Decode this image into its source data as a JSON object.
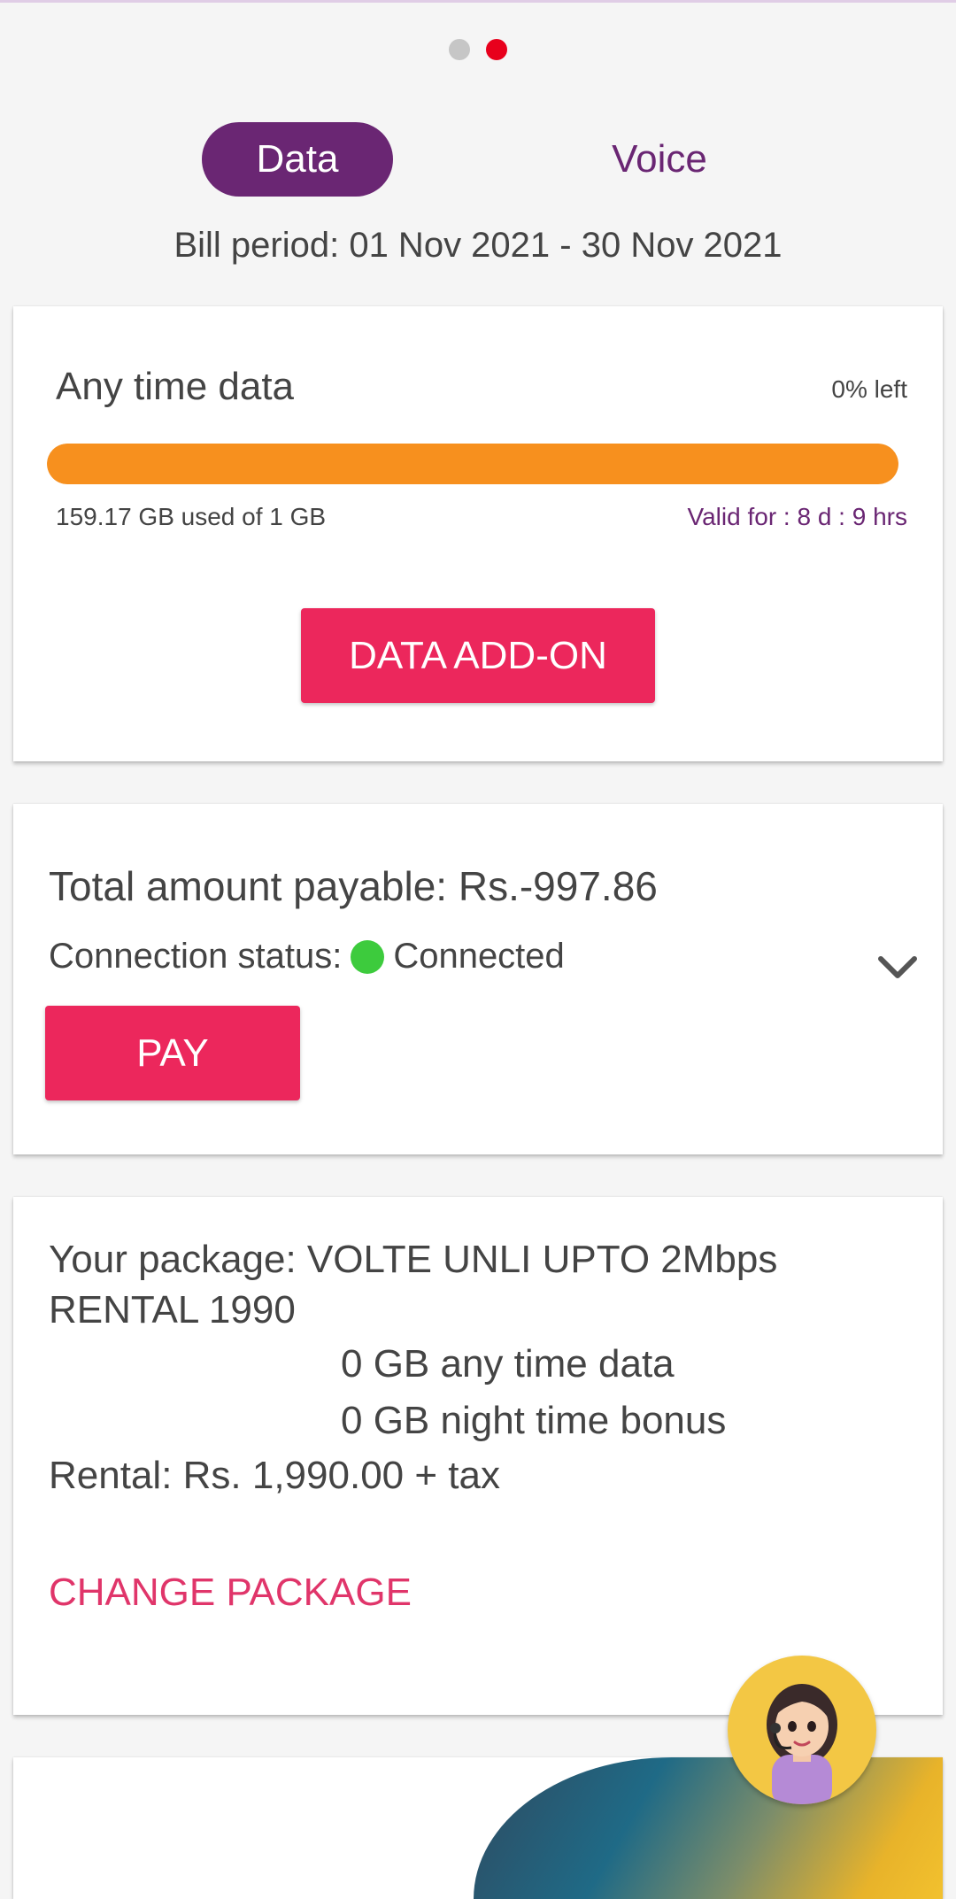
{
  "carousel": {
    "pages": 2,
    "active_index": 1
  },
  "tabs": {
    "data_label": "Data",
    "voice_label": "Voice",
    "active": "Data"
  },
  "bill_period": "Bill period: 01 Nov 2021 - 30 Nov 2021",
  "usage_card": {
    "title": "Any time data",
    "percent_left": "0% left",
    "progress_used_fraction": 1.0,
    "used_text": "159.17 GB used of 1 GB",
    "validity_text": "Valid for : 8 d : 9 hrs",
    "addon_label": "DATA ADD-ON"
  },
  "payment_card": {
    "total_text": "Total amount payable: Rs.-997.86",
    "status_label": "Connection status:",
    "status_value": "Connected",
    "pay_label": "PAY"
  },
  "package_card": {
    "package_text": "Your package:  VOLTE UNLI UPTO 2Mbps RENTAL 1990",
    "anytime_data": "0 GB any time data",
    "night_bonus": "0 GB night time bonus",
    "rental_text": "Rental: Rs. 1,990.00 + tax",
    "change_label": "CHANGE PACKAGE"
  },
  "colors": {
    "brand_purple": "#6a2673",
    "accent_pink": "#ec275c",
    "progress_orange": "#f7901e",
    "status_green": "#3dcb3d",
    "active_dot": "#e8001c"
  },
  "icons": {
    "expand": "chevron-down-icon",
    "assistant": "assistant-avatar-icon"
  }
}
